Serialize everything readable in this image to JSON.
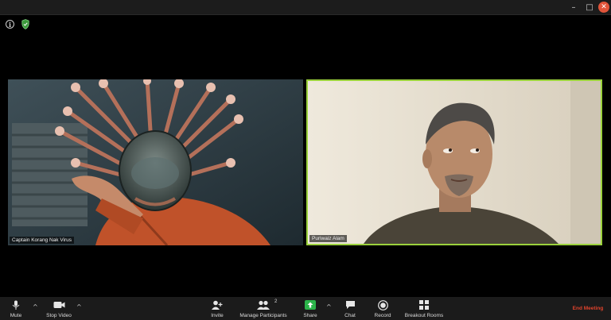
{
  "window": {
    "minimize_glyph": "–",
    "maximize_glyph": "□",
    "close_glyph": "✕"
  },
  "top_icons": {
    "info_glyph": "i"
  },
  "participants": [
    {
      "name": "Captain Korang Nak Virus",
      "video_icon": "virus-mask-person"
    },
    {
      "name": "Puriwaiz Alam",
      "video_icon": "person-in-room",
      "active_speaker": true
    }
  ],
  "toolbar": {
    "mute_label": "Mute",
    "stop_video_label": "Stop Video",
    "invite_label": "Invite",
    "manage_participants_label": "Manage Participants",
    "participant_count": "2",
    "share_label": "Share",
    "chat_label": "Chat",
    "record_label": "Record",
    "breakout_rooms_label": "Breakout Rooms",
    "end_meeting_label": "End Meeting",
    "caret_glyph": "^"
  },
  "colors": {
    "active_speaker_border": "#9bd23c",
    "share_green": "#2cb44a",
    "end_meeting_red": "#e0432c"
  }
}
